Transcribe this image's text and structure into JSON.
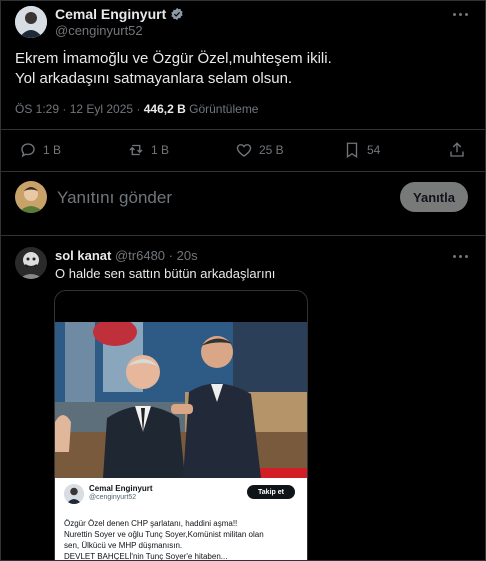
{
  "tweet": {
    "author_name": "Cemal Enginyurt",
    "author_handle": "@cenginyurt52",
    "text_line1": "Ekrem İmamoğlu ve Özgür Özel,muhteşem ikili.",
    "text_line2": "Yol arkadaşını satmayanlara selam olsun.",
    "time": "ÖS 1:29 · 12 Eyl 2025 · ",
    "views_count": "446,2 B",
    "views_label": " Görüntüleme",
    "actions": {
      "reply_count": "1 B",
      "retweet_count": "1 B",
      "like_count": "25 B",
      "bookmark_count": "54"
    }
  },
  "compose": {
    "placeholder": "Yanıtını gönder",
    "reply_button": "Yanıtla"
  },
  "reply": {
    "author_name": "sol kanat",
    "author_handle": "@tr6480",
    "time": "· 20s",
    "text": "O halde sen sattın bütün arkadaşlarını",
    "embed": {
      "author_name": "Cemal Enginyurt",
      "author_handle": "@cenginyurt52",
      "follow_button": "Takip et",
      "line1": "Özgür Özel denen CHP şarlatanı, haddini aşma!!",
      "line2": "Nurettin Soyer ve oğlu Tunç Soyer,Komünist militan olan",
      "line3": "sen, Ülkücü ve MHP düşmanısın.",
      "line4": "DEVLET BAHÇELİ'nin Tunç Soyer'e hitaben..."
    }
  },
  "colors": {
    "background": "#000000",
    "accent": "#1d9bf0",
    "muted": "#71767b",
    "border": "#2f3336"
  }
}
